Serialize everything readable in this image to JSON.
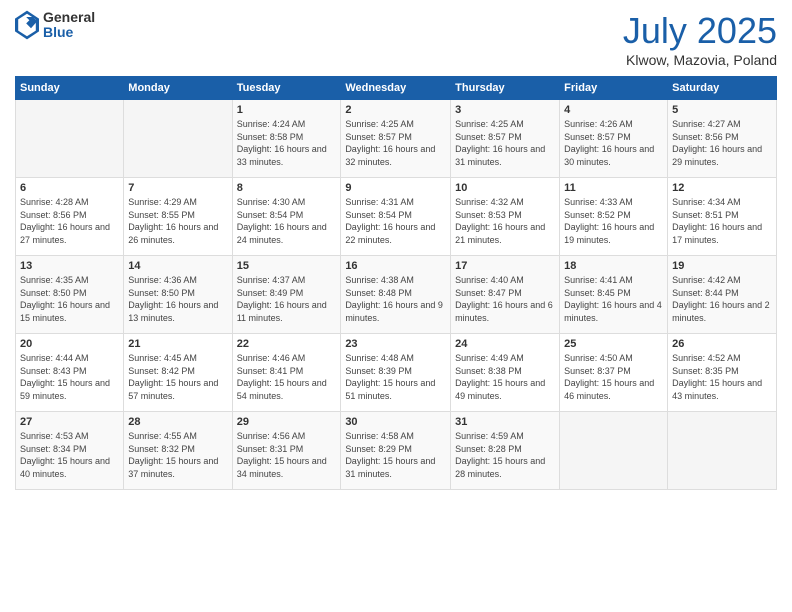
{
  "logo": {
    "general": "General",
    "blue": "Blue"
  },
  "title": "July 2025",
  "location": "Klwow, Mazovia, Poland",
  "days_of_week": [
    "Sunday",
    "Monday",
    "Tuesday",
    "Wednesday",
    "Thursday",
    "Friday",
    "Saturday"
  ],
  "weeks": [
    [
      {
        "day": "",
        "info": ""
      },
      {
        "day": "",
        "info": ""
      },
      {
        "day": "1",
        "sunrise": "Sunrise: 4:24 AM",
        "sunset": "Sunset: 8:58 PM",
        "daylight": "Daylight: 16 hours and 33 minutes."
      },
      {
        "day": "2",
        "sunrise": "Sunrise: 4:25 AM",
        "sunset": "Sunset: 8:57 PM",
        "daylight": "Daylight: 16 hours and 32 minutes."
      },
      {
        "day": "3",
        "sunrise": "Sunrise: 4:25 AM",
        "sunset": "Sunset: 8:57 PM",
        "daylight": "Daylight: 16 hours and 31 minutes."
      },
      {
        "day": "4",
        "sunrise": "Sunrise: 4:26 AM",
        "sunset": "Sunset: 8:57 PM",
        "daylight": "Daylight: 16 hours and 30 minutes."
      },
      {
        "day": "5",
        "sunrise": "Sunrise: 4:27 AM",
        "sunset": "Sunset: 8:56 PM",
        "daylight": "Daylight: 16 hours and 29 minutes."
      }
    ],
    [
      {
        "day": "6",
        "sunrise": "Sunrise: 4:28 AM",
        "sunset": "Sunset: 8:56 PM",
        "daylight": "Daylight: 16 hours and 27 minutes."
      },
      {
        "day": "7",
        "sunrise": "Sunrise: 4:29 AM",
        "sunset": "Sunset: 8:55 PM",
        "daylight": "Daylight: 16 hours and 26 minutes."
      },
      {
        "day": "8",
        "sunrise": "Sunrise: 4:30 AM",
        "sunset": "Sunset: 8:54 PM",
        "daylight": "Daylight: 16 hours and 24 minutes."
      },
      {
        "day": "9",
        "sunrise": "Sunrise: 4:31 AM",
        "sunset": "Sunset: 8:54 PM",
        "daylight": "Daylight: 16 hours and 22 minutes."
      },
      {
        "day": "10",
        "sunrise": "Sunrise: 4:32 AM",
        "sunset": "Sunset: 8:53 PM",
        "daylight": "Daylight: 16 hours and 21 minutes."
      },
      {
        "day": "11",
        "sunrise": "Sunrise: 4:33 AM",
        "sunset": "Sunset: 8:52 PM",
        "daylight": "Daylight: 16 hours and 19 minutes."
      },
      {
        "day": "12",
        "sunrise": "Sunrise: 4:34 AM",
        "sunset": "Sunset: 8:51 PM",
        "daylight": "Daylight: 16 hours and 17 minutes."
      }
    ],
    [
      {
        "day": "13",
        "sunrise": "Sunrise: 4:35 AM",
        "sunset": "Sunset: 8:50 PM",
        "daylight": "Daylight: 16 hours and 15 minutes."
      },
      {
        "day": "14",
        "sunrise": "Sunrise: 4:36 AM",
        "sunset": "Sunset: 8:50 PM",
        "daylight": "Daylight: 16 hours and 13 minutes."
      },
      {
        "day": "15",
        "sunrise": "Sunrise: 4:37 AM",
        "sunset": "Sunset: 8:49 PM",
        "daylight": "Daylight: 16 hours and 11 minutes."
      },
      {
        "day": "16",
        "sunrise": "Sunrise: 4:38 AM",
        "sunset": "Sunset: 8:48 PM",
        "daylight": "Daylight: 16 hours and 9 minutes."
      },
      {
        "day": "17",
        "sunrise": "Sunrise: 4:40 AM",
        "sunset": "Sunset: 8:47 PM",
        "daylight": "Daylight: 16 hours and 6 minutes."
      },
      {
        "day": "18",
        "sunrise": "Sunrise: 4:41 AM",
        "sunset": "Sunset: 8:45 PM",
        "daylight": "Daylight: 16 hours and 4 minutes."
      },
      {
        "day": "19",
        "sunrise": "Sunrise: 4:42 AM",
        "sunset": "Sunset: 8:44 PM",
        "daylight": "Daylight: 16 hours and 2 minutes."
      }
    ],
    [
      {
        "day": "20",
        "sunrise": "Sunrise: 4:44 AM",
        "sunset": "Sunset: 8:43 PM",
        "daylight": "Daylight: 15 hours and 59 minutes."
      },
      {
        "day": "21",
        "sunrise": "Sunrise: 4:45 AM",
        "sunset": "Sunset: 8:42 PM",
        "daylight": "Daylight: 15 hours and 57 minutes."
      },
      {
        "day": "22",
        "sunrise": "Sunrise: 4:46 AM",
        "sunset": "Sunset: 8:41 PM",
        "daylight": "Daylight: 15 hours and 54 minutes."
      },
      {
        "day": "23",
        "sunrise": "Sunrise: 4:48 AM",
        "sunset": "Sunset: 8:39 PM",
        "daylight": "Daylight: 15 hours and 51 minutes."
      },
      {
        "day": "24",
        "sunrise": "Sunrise: 4:49 AM",
        "sunset": "Sunset: 8:38 PM",
        "daylight": "Daylight: 15 hours and 49 minutes."
      },
      {
        "day": "25",
        "sunrise": "Sunrise: 4:50 AM",
        "sunset": "Sunset: 8:37 PM",
        "daylight": "Daylight: 15 hours and 46 minutes."
      },
      {
        "day": "26",
        "sunrise": "Sunrise: 4:52 AM",
        "sunset": "Sunset: 8:35 PM",
        "daylight": "Daylight: 15 hours and 43 minutes."
      }
    ],
    [
      {
        "day": "27",
        "sunrise": "Sunrise: 4:53 AM",
        "sunset": "Sunset: 8:34 PM",
        "daylight": "Daylight: 15 hours and 40 minutes."
      },
      {
        "day": "28",
        "sunrise": "Sunrise: 4:55 AM",
        "sunset": "Sunset: 8:32 PM",
        "daylight": "Daylight: 15 hours and 37 minutes."
      },
      {
        "day": "29",
        "sunrise": "Sunrise: 4:56 AM",
        "sunset": "Sunset: 8:31 PM",
        "daylight": "Daylight: 15 hours and 34 minutes."
      },
      {
        "day": "30",
        "sunrise": "Sunrise: 4:58 AM",
        "sunset": "Sunset: 8:29 PM",
        "daylight": "Daylight: 15 hours and 31 minutes."
      },
      {
        "day": "31",
        "sunrise": "Sunrise: 4:59 AM",
        "sunset": "Sunset: 8:28 PM",
        "daylight": "Daylight: 15 hours and 28 minutes."
      },
      {
        "day": "",
        "info": ""
      },
      {
        "day": "",
        "info": ""
      }
    ]
  ]
}
